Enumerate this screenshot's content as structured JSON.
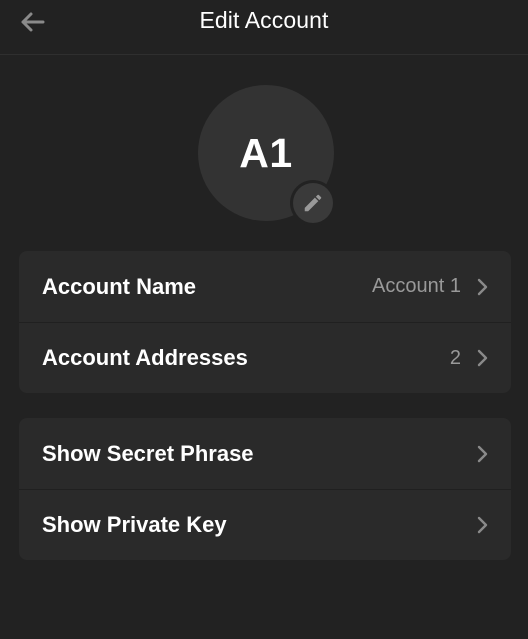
{
  "header": {
    "title": "Edit Account"
  },
  "avatar": {
    "initials": "A1"
  },
  "account_card": {
    "items": [
      {
        "label": "Account Name",
        "value": "Account 1"
      },
      {
        "label": "Account Addresses",
        "value": "2"
      }
    ]
  },
  "security_card": {
    "items": [
      {
        "label": "Show Secret Phrase"
      },
      {
        "label": "Show Private Key"
      }
    ]
  },
  "icons": {
    "back": "arrow-left-icon",
    "edit": "pencil-icon",
    "chevron": "chevron-right-icon"
  },
  "colors": {
    "background": "#222222",
    "card": "#2a2a2a",
    "avatar": "#333333",
    "text_primary": "#ffffff",
    "text_secondary": "#999999"
  }
}
